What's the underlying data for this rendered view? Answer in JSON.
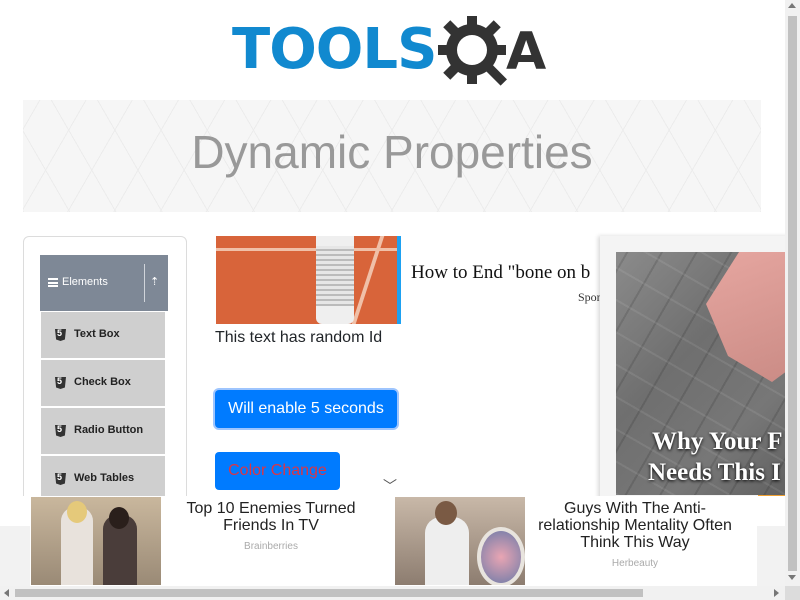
{
  "header": {
    "logo_tools": "TOOLS",
    "logo_q_icon": "gear-magnifier-icon",
    "logo_a": "A"
  },
  "banner": {
    "title": "Dynamic Properties"
  },
  "sidebar": {
    "group": {
      "label": "Elements",
      "icon": "menu-icon",
      "toggle_icon": "collapse-arrow-icon"
    },
    "items": [
      {
        "label": "Text Box",
        "icon": "html5-icon"
      },
      {
        "label": "Check Box",
        "icon": "html5-icon"
      },
      {
        "label": "Radio Button",
        "icon": "html5-icon"
      },
      {
        "label": "Web Tables",
        "icon": "html5-icon"
      }
    ]
  },
  "ad_top": {
    "headline": "How to End \"bone on b",
    "sponsor": "Spon"
  },
  "main": {
    "random_id_text": "This text has random Id",
    "enable_button": "Will enable 5 seconds",
    "color_button": "Color Change",
    "color_button_text_color": "#dc3545",
    "accent": "#007bff"
  },
  "video_ad": {
    "caption_line1": "Why Your F",
    "caption_line2": "Needs This I"
  },
  "bottom_ads": [
    {
      "title": "Top 10 Enemies Turned Friends In TV",
      "source": "Brainberries"
    },
    {
      "title": "Guys With The Anti-relationship Mentality Often Think This Way",
      "source": "Herbeauty"
    }
  ]
}
